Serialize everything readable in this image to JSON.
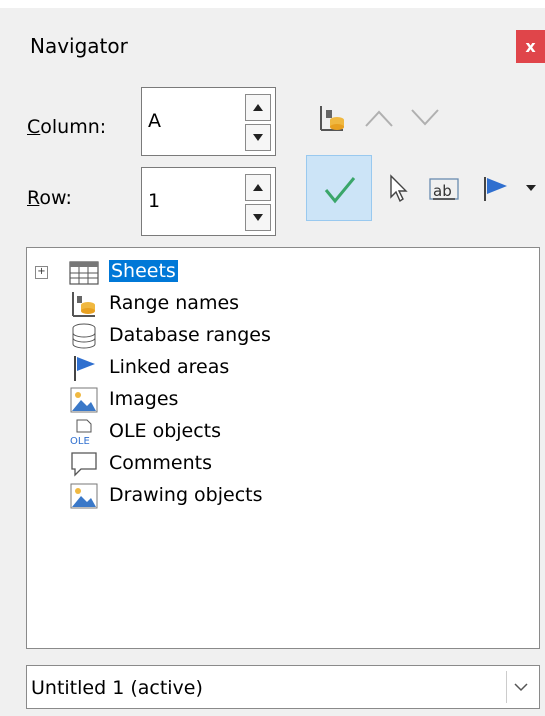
{
  "navigator": {
    "title": "Navigator",
    "close_label": "x",
    "column": {
      "label_mnemonic": "C",
      "label_rest": "olumn:",
      "value": "A"
    },
    "row": {
      "label_mnemonic": "R",
      "label_rest": "ow:",
      "value": "1"
    },
    "toolbar": {
      "icons": [
        "range-names-icon",
        "previous-icon",
        "next-icon",
        "checkmark-icon",
        "drag-mode-icon",
        "show-text-icon",
        "scenarios-icon",
        "dropdown-arrow-icon"
      ]
    },
    "tree": {
      "items": [
        {
          "label": "Sheets",
          "icon": "sheets-icon",
          "expandable": true,
          "selected": true
        },
        {
          "label": "Range names",
          "icon": "range-names-icon"
        },
        {
          "label": "Database ranges",
          "icon": "database-icon"
        },
        {
          "label": "Linked areas",
          "icon": "flag-icon"
        },
        {
          "label": "Images",
          "icon": "image-icon"
        },
        {
          "label": "OLE objects",
          "icon": "ole-icon"
        },
        {
          "label": "Comments",
          "icon": "comment-icon"
        },
        {
          "label": "Drawing objects",
          "icon": "drawing-icon"
        }
      ]
    },
    "document_select": {
      "value": "Untitled 1 (active)"
    }
  }
}
